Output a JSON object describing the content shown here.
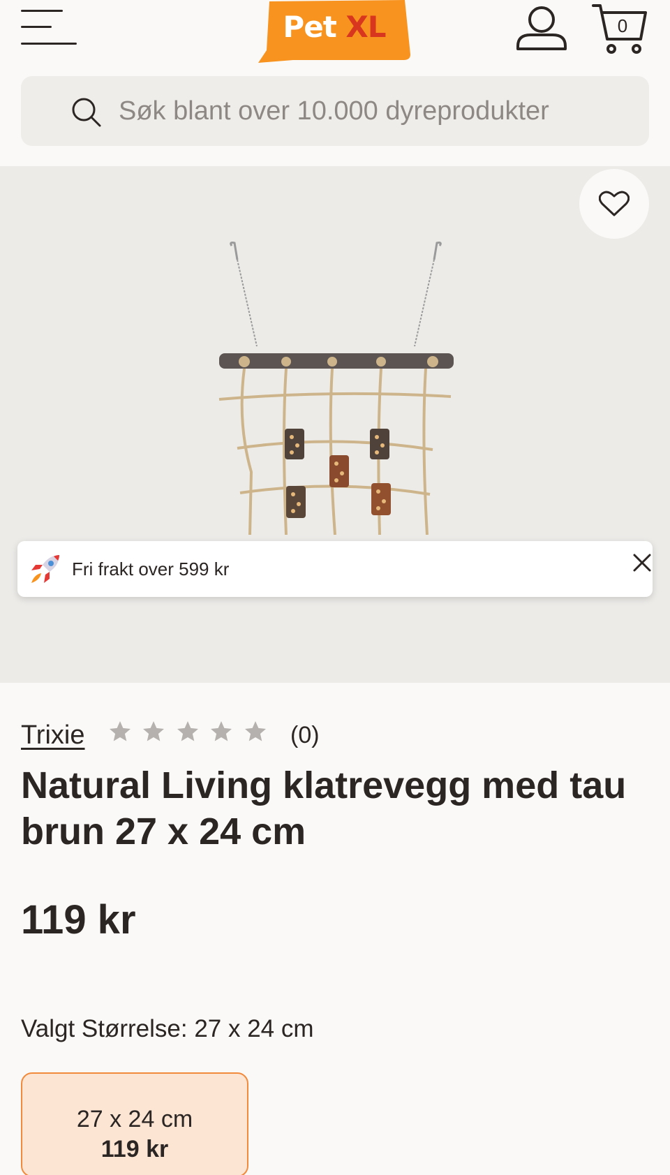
{
  "header": {
    "logo": {
      "part1": "Pet",
      "part2": "XL"
    },
    "cart_count": "0"
  },
  "search": {
    "placeholder": "Søk blant over 10.000 dyreprodukter"
  },
  "toast": {
    "text": "Fri frakt over 599 kr",
    "icon": "rocket-icon"
  },
  "product": {
    "brand": "Trixie",
    "rating": 0,
    "review_count": "(0)",
    "title": "Natural Living klatrevegg med tau brun 27 x 24 cm",
    "price": "119 kr",
    "selected_size_label": "Valgt Størrelse: 27 x 24 cm",
    "sizes": [
      {
        "size": "27 x 24 cm",
        "price": "119 kr"
      }
    ]
  },
  "colors": {
    "brand_orange": "#f7931e",
    "logo_red": "#d9361f",
    "background": "#faf9f7",
    "text": "#2b2624",
    "selected_option_bg": "#fde5d3",
    "selected_option_border": "#f28a3c"
  }
}
